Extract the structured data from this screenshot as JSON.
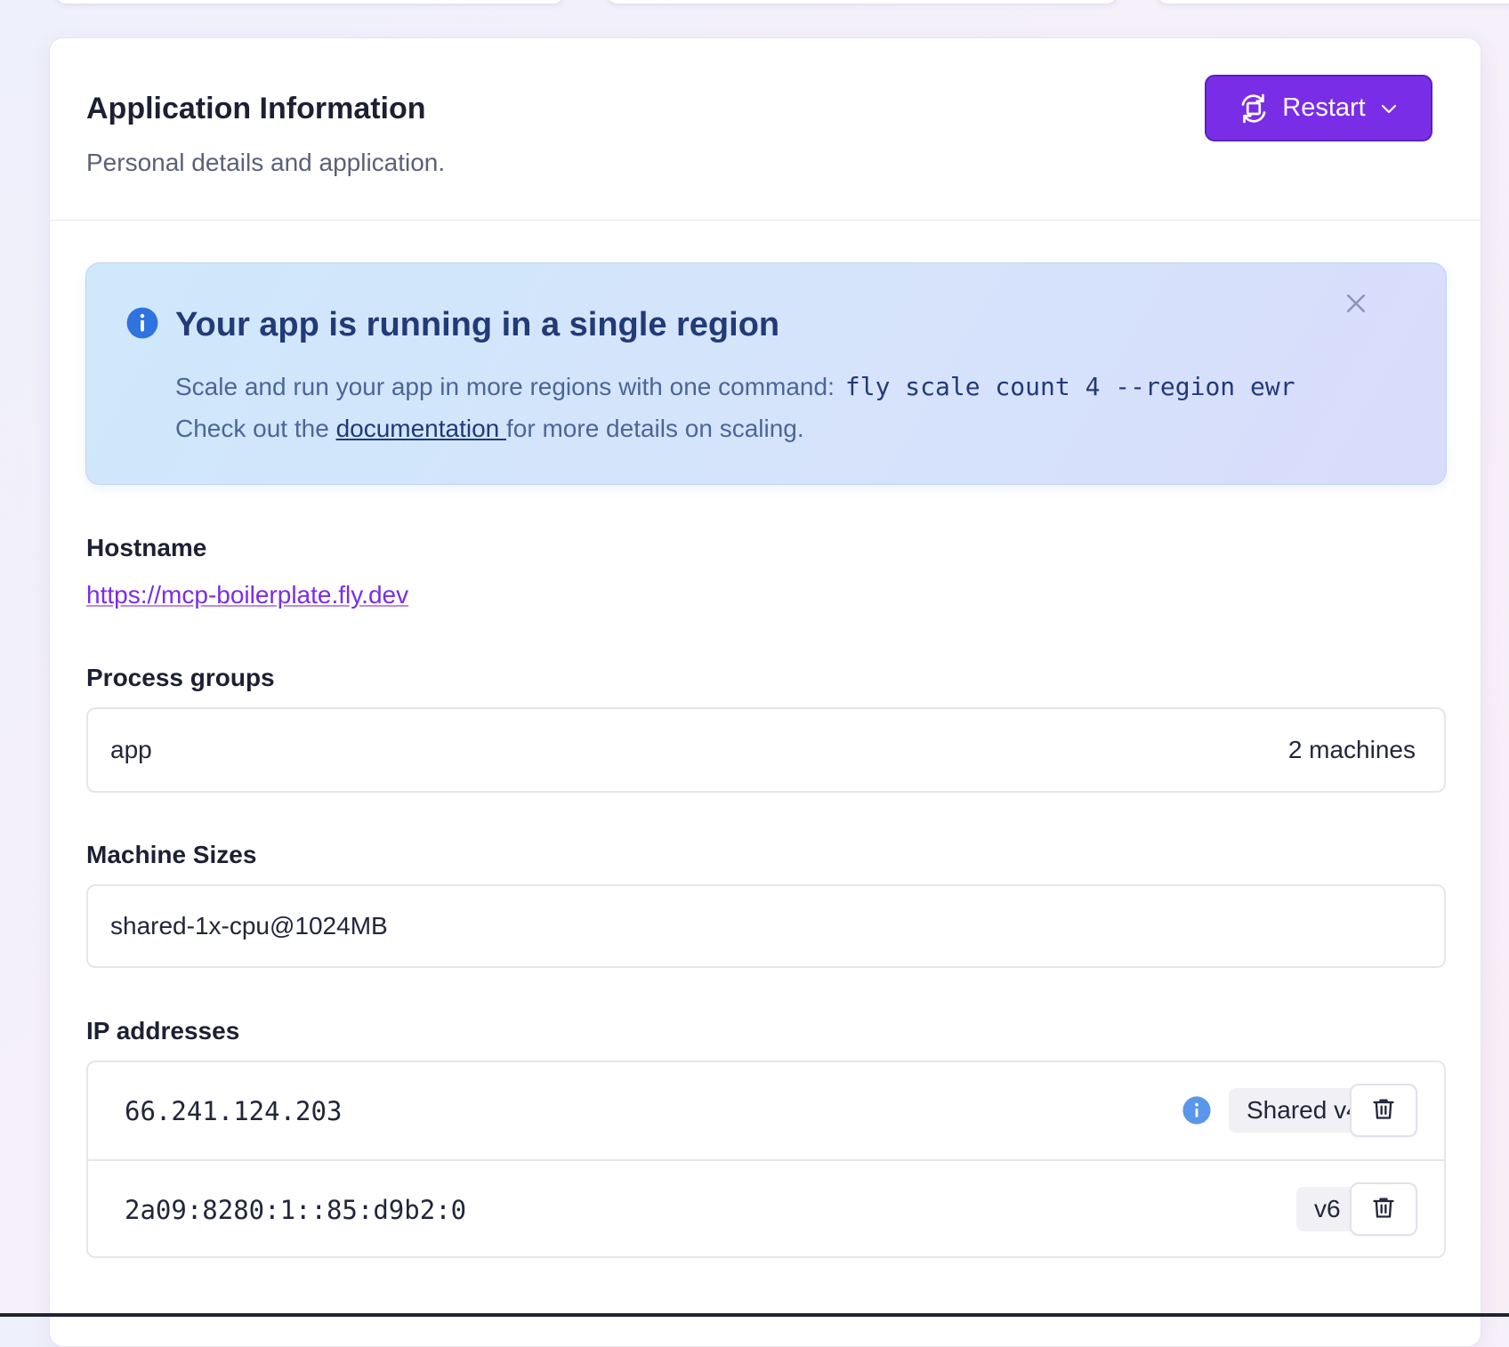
{
  "card": {
    "title": "Application Information",
    "subtitle": "Personal details and application.",
    "restart_label": "Restart"
  },
  "alert": {
    "title": "Your app is running in a single region",
    "line1_text": "Scale and run your app in more regions with one command:",
    "command": "fly scale count 4 --region ewr",
    "line2_prefix": "Check out the",
    "link_text": "documentation ",
    "line2_suffix": "for more details on scaling."
  },
  "hostname": {
    "label": "Hostname",
    "url": "https://mcp-boilerplate.fly.dev"
  },
  "process_groups": {
    "label": "Process groups",
    "name": "app",
    "count": "2 machines"
  },
  "machine_sizes": {
    "label": "Machine Sizes",
    "value": "shared-1x-cpu@1024MB"
  },
  "ip_addresses": {
    "label": "IP addresses",
    "rows": [
      {
        "address": "66.241.124.203",
        "badge": "Shared v4",
        "has_info": true
      },
      {
        "address": "2a09:8280:1::85:d9b2:0",
        "badge": "v6",
        "has_info": false
      }
    ]
  },
  "colors": {
    "accent": "#7a2de6",
    "alert_bg": "#d6e3fb",
    "alert_title": "#233a78",
    "info_icon": "#2f73e0"
  },
  "icons": {
    "restart": "refresh-icon",
    "dropdown": "chevron-down-icon",
    "alert": "info-icon",
    "close": "close-icon",
    "delete": "trash-icon"
  }
}
